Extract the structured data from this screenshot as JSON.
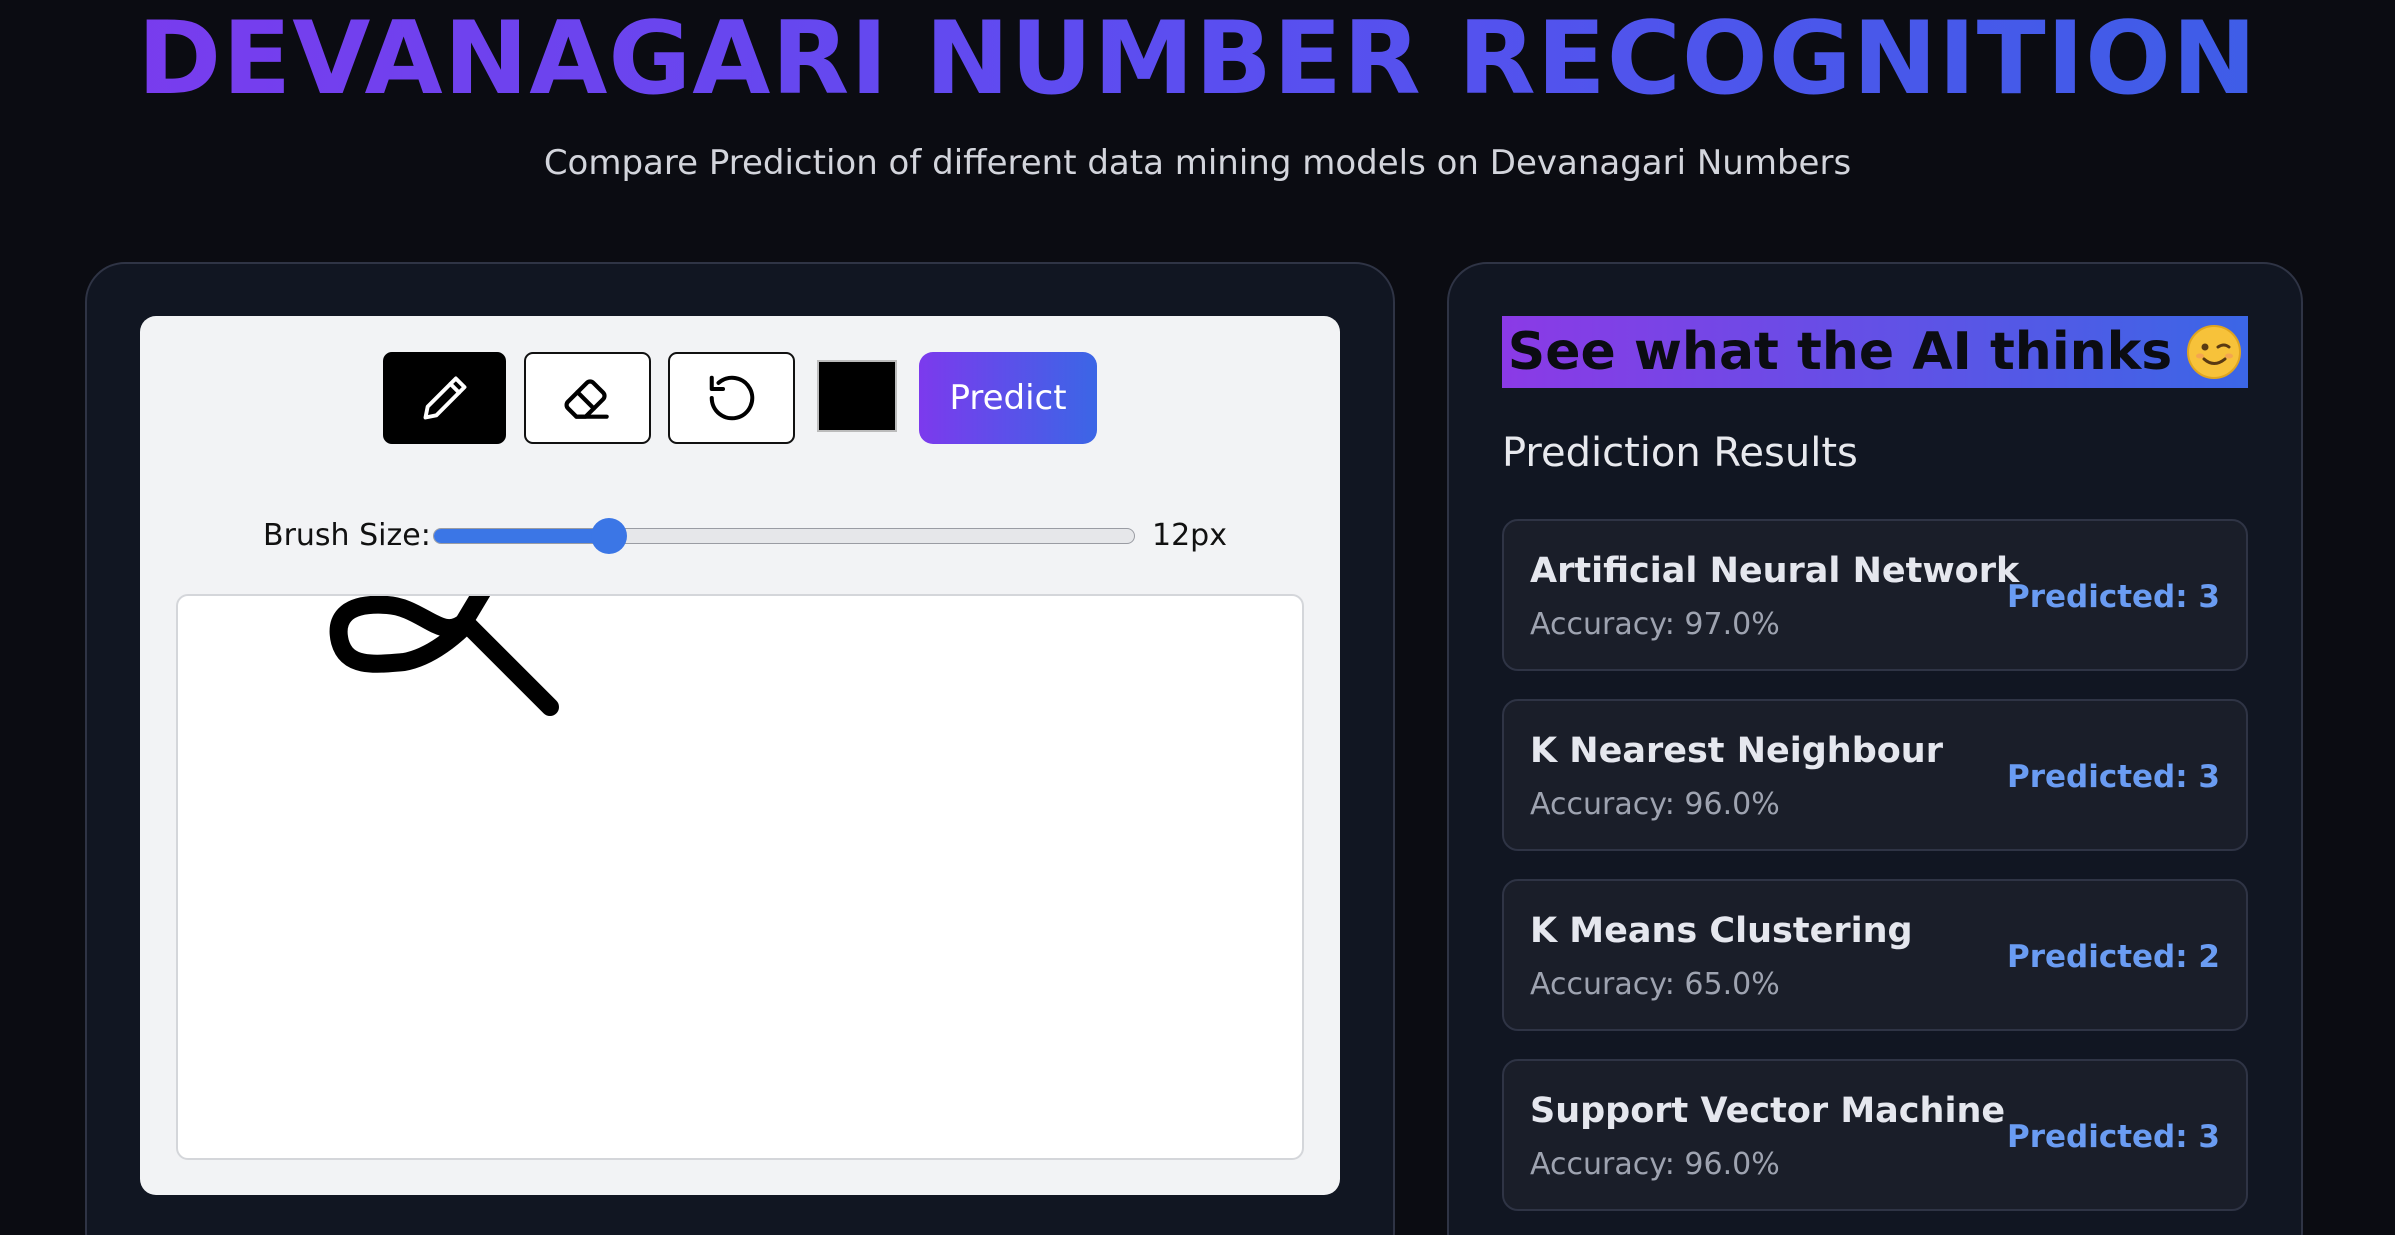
{
  "header": {
    "title": "DEVANAGARI NUMBER RECOGNITION",
    "subtitle": "Compare Prediction of different data mining models on Devanagari Numbers"
  },
  "toolbar": {
    "tools": [
      {
        "name": "pencil-icon",
        "active": true
      },
      {
        "name": "eraser-icon",
        "active": false
      },
      {
        "name": "reset-icon",
        "active": false
      }
    ],
    "brush_color": "#000000",
    "predict_label": "Predict"
  },
  "brush": {
    "label": "Brush Size:",
    "value_text": "12px",
    "level_fraction": 0.25
  },
  "canvas": {
    "stroke_color": "#000000",
    "drawn_glyph": "devanagari-digit-3"
  },
  "results": {
    "banner": "See what the AI thinks",
    "banner_emoji": "winking-face-icon",
    "heading": "Prediction Results",
    "models": [
      {
        "name": "Artificial Neural Network",
        "accuracy": "Accuracy: 97.0%",
        "prediction": "Predicted: 3"
      },
      {
        "name": "K Nearest Neighbour",
        "accuracy": "Accuracy: 96.0%",
        "prediction": "Predicted: 3"
      },
      {
        "name": "K Means Clustering",
        "accuracy": "Accuracy: 65.0%",
        "prediction": "Predicted: 2"
      },
      {
        "name": "Support Vector Machine",
        "accuracy": "Accuracy: 96.0%",
        "prediction": "Predicted: 3"
      }
    ]
  },
  "colors": {
    "background": "#0b0c12",
    "panel": "#111622",
    "accent_purple": "#7c3aed",
    "accent_blue": "#3b66e6",
    "prediction_text": "#6a9cf2"
  }
}
